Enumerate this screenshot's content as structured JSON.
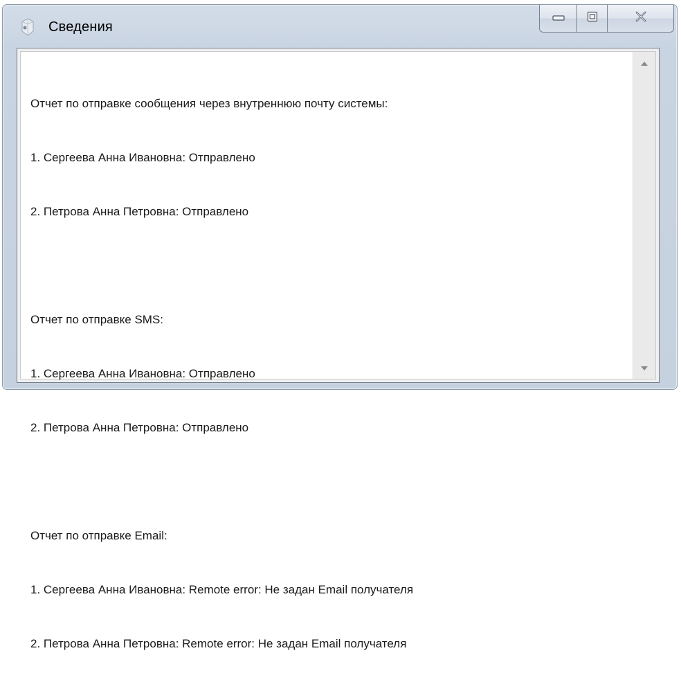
{
  "window": {
    "title": "Сведения",
    "app_icon": "app-icon",
    "controls": {
      "minimize_icon": "minimize-icon",
      "maximize_icon": "maximize-icon",
      "close_icon": "close-icon"
    }
  },
  "report": {
    "lines": [
      "Отчет по отправке сообщения через внутреннюю почту системы:",
      "1. Сергеева Анна Ивановна: Отправлено",
      "2. Петрова Анна Петровна: Отправлено",
      "",
      "Отчет по отправке SMS:",
      "1. Сергеева Анна Ивановна: Отправлено",
      "2. Петрова Анна Петровна: Отправлено",
      "",
      "Отчет по отправке Email:",
      "1. Сергеева Анна Ивановна: Remote error: Не задан Email получателя",
      "2. Петрова Анна Петровна: Remote error: Не задан Email получателя"
    ]
  },
  "scrollbar": {
    "up_icon": "scroll-up-arrow-icon",
    "down_icon": "scroll-down-arrow-icon"
  },
  "colors": {
    "frame": "#c9d4e2",
    "text": "#1a1a1a",
    "scrollbar_bg": "#eaeaea"
  }
}
